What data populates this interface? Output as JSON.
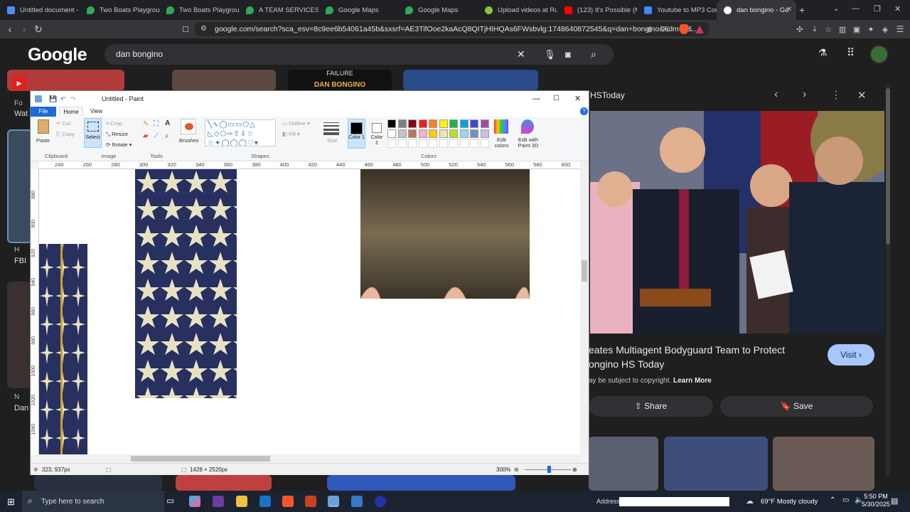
{
  "browser": {
    "tabs": [
      {
        "title": "Untitled document - G",
        "color": "#4f8df5"
      },
      {
        "title": "Two Boats Playground",
        "color": "#34a853"
      },
      {
        "title": "Two Boats Playground",
        "color": "#34a853"
      },
      {
        "title": "A TEAM SERVICES He",
        "color": "#34a853"
      },
      {
        "title": "Google Maps",
        "color": "#34a853"
      },
      {
        "title": "Google Maps",
        "color": "#34a853"
      },
      {
        "title": "Upload videos at Rum",
        "color": "#85c742"
      },
      {
        "title": "(123) It's Possible (Mu",
        "color": "#ff0000"
      },
      {
        "title": "Youtube to MP3 Conv",
        "color": "#4285f4"
      },
      {
        "title": "dan bongino - Go",
        "color": "#ffffff"
      }
    ],
    "url": "google.com/search?sca_esv=8c9ee6b54061a45b&sxsrf=AE3TifOoe2kaAcQ8QITjHIHQAs6FWsbvlg:1748640872545&q=dan+bongino&udm=2&..."
  },
  "google": {
    "logo": "Google",
    "query": "dan bongino",
    "left_snippets": [
      "Fo",
      "Wat",
      "H",
      "FBI",
      "N",
      "Dan"
    ],
    "banner_text": "DAN BONGINO",
    "banner_top": "FAILURE"
  },
  "panel": {
    "source": "HSToday",
    "title_line1": "eates Multiagent Bodyguard Team to Protect",
    "title_line2": "ongino HS Today",
    "copyright_prefix": "ay be subject to copyright.",
    "learn_more": "Learn More",
    "visit": "Visit",
    "share": "Share",
    "save": "Save"
  },
  "paint": {
    "title": "Untitled - Paint",
    "menu": {
      "file": "File",
      "home": "Home",
      "view": "View"
    },
    "ribbon": {
      "paste": "Paste",
      "cut": "Cut",
      "copy": "Copy",
      "select": "Select",
      "crop": "Crop",
      "resize": "Resize",
      "rotate": "Rotate",
      "brushes": "Brushes",
      "outline": "Outline",
      "fill": "Fill",
      "size": "Size",
      "color1": "Color 1",
      "color2": "Color 2",
      "edit_colors": "Edit colors",
      "edit_paint3d": "Edit with Paint 3D",
      "groups": {
        "clipboard": "Clipboard",
        "image": "Image",
        "tools": "Tools",
        "shapes": "Shapes",
        "colors": "Colors"
      }
    },
    "ruler_h": [
      "240",
      "260",
      "280",
      "300",
      "320",
      "340",
      "360",
      "380",
      "400",
      "420",
      "440",
      "460",
      "480",
      "500",
      "520",
      "540",
      "560",
      "580",
      "600"
    ],
    "ruler_v": [
      "880",
      "900",
      "920",
      "940",
      "960",
      "980",
      "1000",
      "1020",
      "1040"
    ],
    "status": {
      "cursor": "323, 937px",
      "size": "1428 × 2520px",
      "zoom": "300%"
    },
    "palette": [
      "#000000",
      "#7f7f7f",
      "#880015",
      "#ed1c24",
      "#ff7f27",
      "#fff200",
      "#22b14c",
      "#00a2e8",
      "#3f48cc",
      "#a349a4",
      "#ffffff",
      "#c3c3c3",
      "#b97a57",
      "#ffaec9",
      "#ffc90e",
      "#efe4b0",
      "#b5e61d",
      "#99d9ea",
      "#7092be",
      "#c8bfe7"
    ]
  },
  "taskbar": {
    "search": "Type here to search",
    "address": "Address",
    "weather": "69°F  Mostly cloudy",
    "time": "5:50 PM",
    "date": "5/30/2025"
  }
}
